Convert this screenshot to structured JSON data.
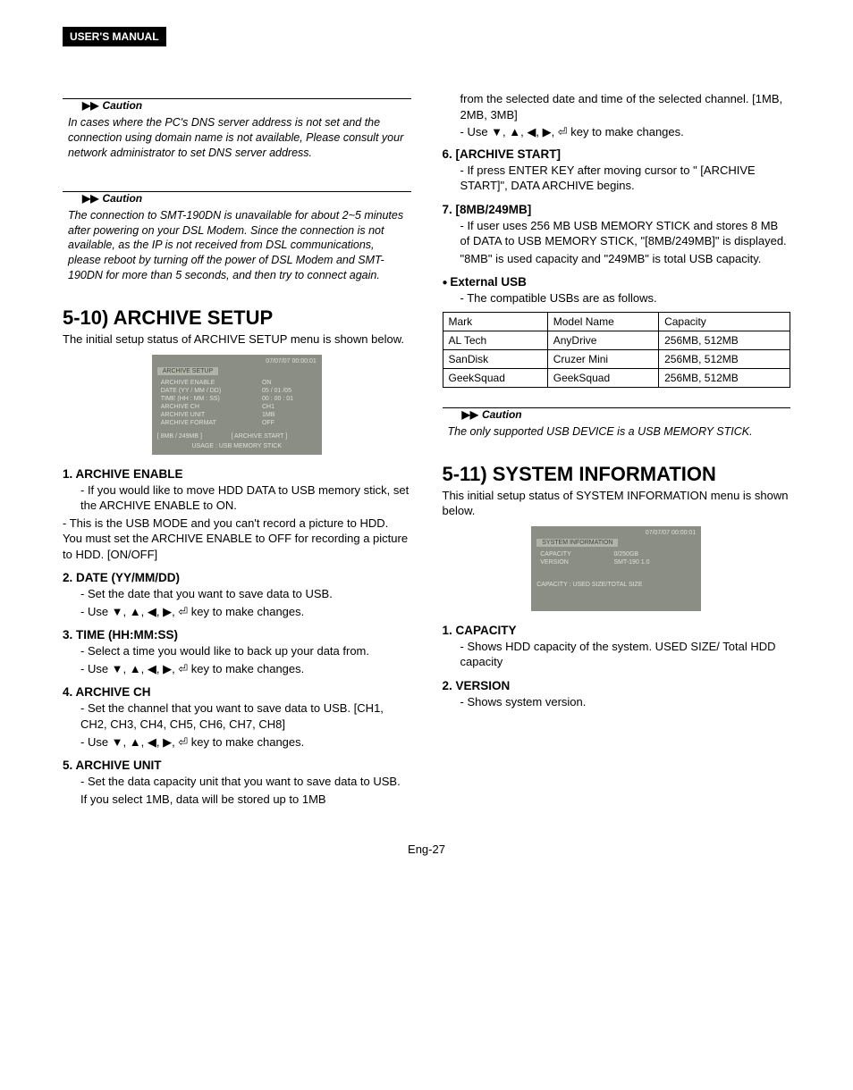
{
  "header": {
    "label": "USER'S MANUAL"
  },
  "left": {
    "caution1": {
      "label": "Caution",
      "text": "In cases where the PC's DNS server address is not set and the connection using domain name is not available, Please consult your network administrator to set DNS server address."
    },
    "caution2": {
      "label": "Caution",
      "text": "The connection to SMT-190DN is unavailable for about 2~5 minutes after powering on your DSL Modem. Since the connection is not available, as the IP is not received from DSL communications, please reboot by turning off the power of DSL Modem and SMT-190DN for more than 5 seconds, and then try to connect again."
    },
    "section": {
      "title": "5-10) ARCHIVE SETUP",
      "intro": "The initial setup status of ARCHIVE SETUP menu is shown below."
    },
    "screenshot": {
      "time": "07/07/07  00:00:01",
      "tab": "ARCHIVE SETUP",
      "rows": [
        [
          "ARCHIVE ENABLE",
          "ON"
        ],
        [
          "DATE (YY / MM / DD)",
          "05 / 01 /05"
        ],
        [
          "TIME (HH : MM : SS)",
          "00 : 00 : 01"
        ],
        [
          "ARCHIVE CH",
          "CH1"
        ],
        [
          "ARCHIVE UNIT",
          "1MB"
        ],
        [
          "ARCHIVE FORMAT",
          "OFF"
        ]
      ],
      "start": "[ ARCHIVE START ]",
      "cap": "[ 8MB / 249MB ]",
      "usage": "USAGE : USB MEMORY STICK"
    },
    "items": [
      {
        "title": "1. ARCHIVE ENABLE",
        "lines": [
          "- If you would like to move HDD DATA to USB memory stick, set the ARCHIVE ENABLE to ON.",
          "- This is the USB MODE and you can't record a picture to HDD. You must set the ARCHIVE ENABLE to OFF for recording a picture to HDD. [ON/OFF]"
        ]
      },
      {
        "title": "2. DATE (YY/MM/DD)",
        "lines": [
          "- Set the date that you want to save data to USB.",
          "- Use ▼, ▲, ◀, ▶, ⏎  key to make changes."
        ]
      },
      {
        "title": "3. TIME (HH:MM:SS)",
        "lines": [
          "- Select a time you would like to back up your data from.",
          "- Use ▼, ▲, ◀, ▶, ⏎  key to make changes."
        ]
      },
      {
        "title": "4. ARCHIVE CH",
        "lines": [
          "- Set the channel that you want to save data to USB. [CH1, CH2, CH3, CH4, CH5, CH6, CH7, CH8]",
          "- Use ▼, ▲, ◀, ▶, ⏎  key to make changes."
        ]
      },
      {
        "title": "5. ARCHIVE UNIT",
        "lines": [
          "- Set the data capacity unit that you want to save data to USB.",
          "If you select 1MB, data will be stored up to 1MB"
        ]
      }
    ]
  },
  "right": {
    "cont": [
      "from the selected date and time of the selected channel. [1MB, 2MB, 3MB]",
      "- Use ▼, ▲, ◀, ▶, ⏎  key to make changes."
    ],
    "items": [
      {
        "title": "6. [ARCHIVE START]",
        "lines": [
          "- If press ENTER KEY after moving cursor to \" [ARCHIVE START]\", DATA  ARCHIVE begins."
        ]
      },
      {
        "title": "7. [8MB/249MB]",
        "lines": [
          "- If user uses 256 MB USB MEMORY STICK and stores 8 MB of DATA to USB MEMORY STICK, \"[8MB/249MB]\" is displayed.",
          "\"8MB\" is used capacity and \"249MB\" is total USB capacity."
        ]
      }
    ],
    "external": {
      "title": "External USB",
      "intro": "- The compatible USBs are as follows.",
      "headers": [
        "Mark",
        "Model Name",
        "Capacity"
      ],
      "rows": [
        [
          "AL Tech",
          "AnyDrive",
          "256MB, 512MB"
        ],
        [
          "SanDisk",
          "Cruzer Mini",
          "256MB, 512MB"
        ],
        [
          "GeekSquad",
          "GeekSquad",
          "256MB, 512MB"
        ]
      ]
    },
    "caution": {
      "label": "Caution",
      "text": "The only supported USB DEVICE is a USB MEMORY STICK."
    },
    "section": {
      "title": "5-11) SYSTEM INFORMATION",
      "intro": "This initial setup status of SYSTEM INFORMATION menu is shown below."
    },
    "screenshot2": {
      "time": "07/07/07  00:00:01",
      "tab": "SYSTEM INFORMATION",
      "rows": [
        [
          "CAPACITY",
          "0/250GB"
        ],
        [
          "VERSION",
          "SMT-190 1.0"
        ]
      ],
      "note": "CAPACITY : USED SIZE/TOTAL SIZE"
    },
    "items2": [
      {
        "title": "1. CAPACITY",
        "lines": [
          "- Shows HDD capacity of the system. USED SIZE/ Total HDD capacity"
        ]
      },
      {
        "title": "2. VERSION",
        "lines": [
          "- Shows system version."
        ]
      }
    ]
  },
  "footer": "Eng-27"
}
